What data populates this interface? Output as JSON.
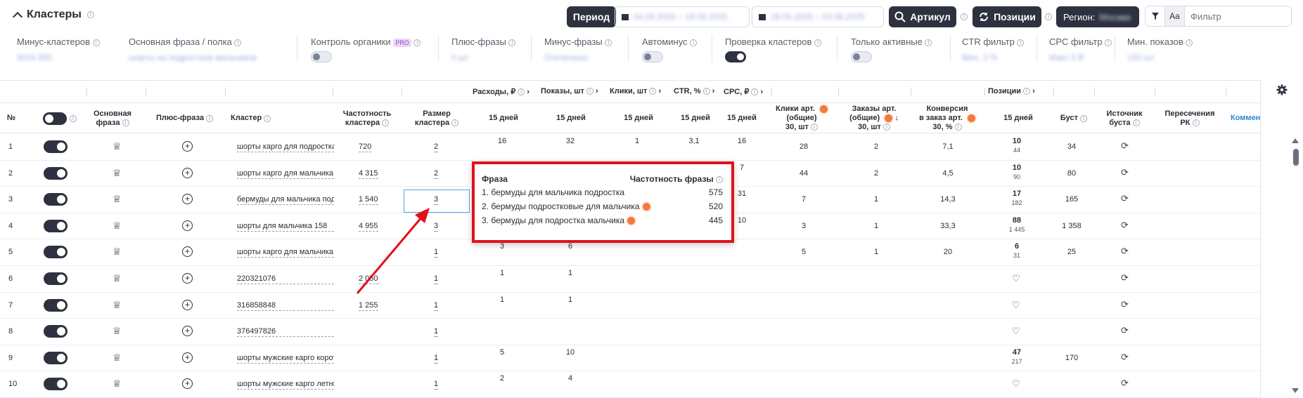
{
  "section": {
    "title": "Кластеры"
  },
  "toolbar": {
    "period_label": "Период",
    "date_range_1": "04.06.2025 – 18.06.2025",
    "date_range_2": "28.05.2025 – 03.06.2025",
    "article_label": "Артикул",
    "positions_label": "Позиции",
    "region_label": "Регион:",
    "region_value": "Москва",
    "case_label": "Aa",
    "filter_placeholder": "Фильтр"
  },
  "controls": {
    "minus_clusters": {
      "label": "Минус-кластеров",
      "value": "5024 850"
    },
    "main_phrase": {
      "label": "Основная фраза / полка",
      "value": "шорты на подростков мальчиков"
    },
    "organic": {
      "label": "Контроль органики",
      "badge": "PRO"
    },
    "plus_phrases": {
      "label": "Плюс-фразы",
      "value": "0 шт"
    },
    "minus_phrases": {
      "label": "Минус-фразы",
      "value": "Отключено"
    },
    "autominus": {
      "label": "Автоминус"
    },
    "check_clusters": {
      "label": "Проверка кластеров"
    },
    "only_active": {
      "label": "Только активные"
    },
    "ctr_filter": {
      "label": "CTR фильтр",
      "value": "Мин. 3 %"
    },
    "cpc_filter": {
      "label": "CPC фильтр",
      "value": "Макс 0 ₽"
    },
    "min_shows": {
      "label": "Мин. показов",
      "value": "100 шт"
    }
  },
  "header1": {
    "expenses": "Расходы, ₽",
    "shows": "Показы, шт",
    "clicks": "Клики, шт",
    "ctr": "CTR, %",
    "cpc": "CPC, ₽",
    "positions": "Позиции"
  },
  "header2": {
    "num": "№",
    "main_phrase": [
      "Основная",
      "фраза"
    ],
    "plus_phrase": "Плюс-фраза",
    "cluster": "Кластер",
    "frequency": [
      "Частотность",
      "кластера"
    ],
    "size": [
      "Размер",
      "кластера"
    ],
    "d15": "15 дней",
    "art_clicks": [
      "Клики арт.",
      "(общие)",
      "30, шт"
    ],
    "art_orders": [
      "Заказы арт.",
      "(общие)",
      "30, шт"
    ],
    "conversion": [
      "Конверсия",
      "в заказ арт.",
      "30, %"
    ],
    "boost": "Буст",
    "boost_source": [
      "Источник",
      "буста"
    ],
    "rk_cross": [
      "Пересечения",
      "РК"
    ],
    "comment": "Коммен"
  },
  "rows": [
    {
      "n": "1",
      "cluster": "шорты карго для подростка",
      "freq": "720",
      "size": "2",
      "exp": "16",
      "shows": "32",
      "clicks": "1",
      "ctr": "3,1",
      "cpc": "16",
      "art_clicks": "28",
      "art_orders": "2",
      "conv": "7,1",
      "pos": "10",
      "pos_sub": "44",
      "boost": "34"
    },
    {
      "n": "2",
      "cluster": "шорты карго для мальчика",
      "freq": "4 315",
      "size": "2",
      "exp": "",
      "shows": "",
      "clicks": "",
      "ctr": "",
      "cpc": "7",
      "art_clicks": "44",
      "art_orders": "2",
      "conv": "4,5",
      "pos": "10",
      "pos_sub": "90",
      "boost": "80"
    },
    {
      "n": "3",
      "cluster": "бермуды для мальчика подростка",
      "freq": "1 540",
      "size": "3",
      "exp": "",
      "shows": "",
      "clicks": "",
      "ctr": "",
      "cpc": "31",
      "art_clicks": "7",
      "art_orders": "1",
      "conv": "14,3",
      "pos": "17",
      "pos_sub": "182",
      "boost": "165"
    },
    {
      "n": "4",
      "cluster": "шорты для мальчика 158",
      "freq": "4 955",
      "size": "3",
      "exp": "",
      "shows": "",
      "clicks": "",
      "ctr": "",
      "cpc": "10",
      "art_clicks": "3",
      "art_orders": "1",
      "conv": "33,3",
      "pos": "88",
      "pos_sub": "1 445",
      "boost": "1 358"
    },
    {
      "n": "5",
      "cluster": "шорты карго для мальчика",
      "freq": "",
      "size": "1",
      "exp": "3",
      "shows": "6",
      "clicks": "",
      "ctr": "",
      "cpc": "",
      "art_clicks": "5",
      "art_orders": "1",
      "conv": "20",
      "pos": "6",
      "pos_sub": "31",
      "boost": "25"
    },
    {
      "n": "6",
      "cluster": "220321076",
      "freq": "2 050",
      "size": "1",
      "exp": "1",
      "shows": "1",
      "clicks": "",
      "ctr": "",
      "cpc": "",
      "art_clicks": "",
      "art_orders": "",
      "conv": "",
      "pos": "",
      "pos_sub": "",
      "boost": ""
    },
    {
      "n": "7",
      "cluster": "316858848",
      "freq": "1 255",
      "size": "1",
      "exp": "1",
      "shows": "1",
      "clicks": "",
      "ctr": "",
      "cpc": "",
      "art_clicks": "",
      "art_orders": "",
      "conv": "",
      "pos": "",
      "pos_sub": "",
      "boost": ""
    },
    {
      "n": "8",
      "cluster": "376497826",
      "freq": "",
      "size": "1",
      "exp": "",
      "shows": "",
      "clicks": "",
      "ctr": "",
      "cpc": "",
      "art_clicks": "",
      "art_orders": "",
      "conv": "",
      "pos": "",
      "pos_sub": "",
      "boost": ""
    },
    {
      "n": "9",
      "cluster": "шорты мужские карго короткие",
      "freq": "",
      "size": "1",
      "exp": "5",
      "shows": "10",
      "clicks": "",
      "ctr": "",
      "cpc": "",
      "art_clicks": "",
      "art_orders": "",
      "conv": "",
      "pos": "47",
      "pos_sub": "217",
      "boost": "170"
    },
    {
      "n": "10",
      "cluster": "шорты мужские карго летние",
      "freq": "",
      "size": "1",
      "exp": "2",
      "shows": "4",
      "clicks": "",
      "ctr": "",
      "cpc": "",
      "art_clicks": "",
      "art_orders": "",
      "conv": "",
      "pos": "",
      "pos_sub": "",
      "boost": ""
    }
  ],
  "popup": {
    "col_phrase": "Фраза",
    "col_freq": "Частотность фразы",
    "items": [
      {
        "phrase": "1. бермуды для мальчика подростка",
        "freq": "575",
        "dot": false
      },
      {
        "phrase": "2. бермуды подростковые для мальчика",
        "freq": "520",
        "dot": true
      },
      {
        "phrase": "3. бермуды для подростка мальчика",
        "freq": "445",
        "dot": true
      }
    ]
  },
  "colors": {
    "dark": "#2e3240",
    "accent_red": "#e3101b",
    "orange_dot": "#f27b3c",
    "link": "#2f86d6"
  }
}
